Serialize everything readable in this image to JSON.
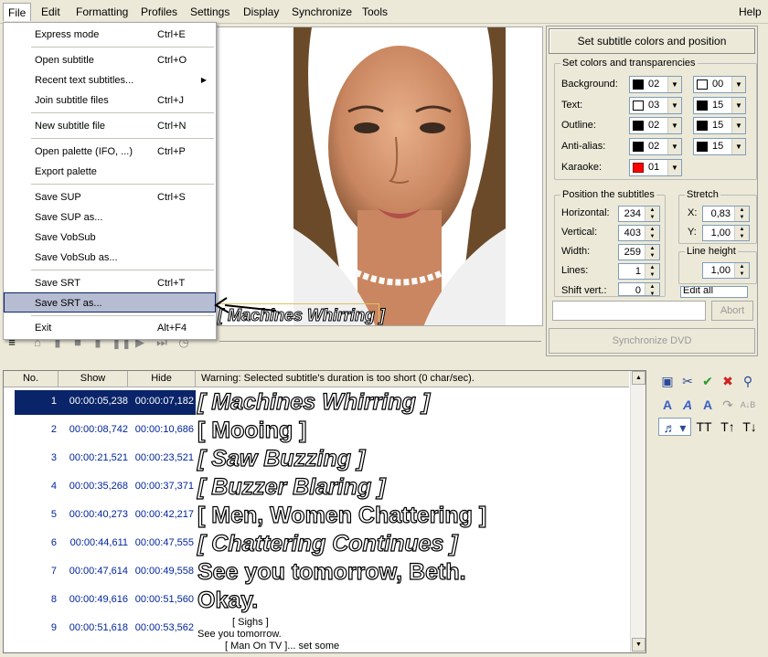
{
  "menubar": {
    "items": [
      {
        "label": "File"
      },
      {
        "label": "Edit"
      },
      {
        "label": "Formatting"
      },
      {
        "label": "Profiles"
      },
      {
        "label": "Settings"
      },
      {
        "label": "Display"
      },
      {
        "label": "Synchronize"
      },
      {
        "label": "Tools"
      }
    ],
    "help": "Help"
  },
  "file_menu": {
    "items": [
      {
        "label": "Express mode",
        "shortcut": "Ctrl+E"
      },
      {
        "label": "Open subtitle",
        "shortcut": "Ctrl+O"
      },
      {
        "label": "Recent text subtitles...",
        "shortcut": ""
      },
      {
        "label": "Join subtitle files",
        "shortcut": "Ctrl+J"
      },
      {
        "label": "New subtitle file",
        "shortcut": "Ctrl+N"
      },
      {
        "label": "Open palette (IFO, ...)",
        "shortcut": "Ctrl+P"
      },
      {
        "label": "Export palette",
        "shortcut": ""
      },
      {
        "label": "Save SUP",
        "shortcut": "Ctrl+S"
      },
      {
        "label": "Save SUP as...",
        "shortcut": ""
      },
      {
        "label": "Save VobSub",
        "shortcut": ""
      },
      {
        "label": "Save VobSub as...",
        "shortcut": ""
      },
      {
        "label": "Save SRT",
        "shortcut": "Ctrl+T"
      },
      {
        "label": "Save SRT as...",
        "shortcut": ""
      },
      {
        "label": "Exit",
        "shortcut": "Alt+F4"
      }
    ]
  },
  "preview": {
    "subtitle_text": "[ Machines Whirring ]"
  },
  "right_panel": {
    "set_colors_button": "Set subtitle colors and position",
    "colors_group": "Set colors and transparencies",
    "color_rows": [
      {
        "label": "Background:",
        "c1_color": "#000000",
        "c1_value": "02",
        "c2_color": "#ffffff",
        "c2_value": "00"
      },
      {
        "label": "Text:",
        "c1_color": "#ffffff",
        "c1_value": "03",
        "c2_color": "#000000",
        "c2_value": "15"
      },
      {
        "label": "Outline:",
        "c1_color": "#000000",
        "c1_value": "02",
        "c2_color": "#000000",
        "c2_value": "15"
      },
      {
        "label": "Anti-alias:",
        "c1_color": "#000000",
        "c1_value": "02",
        "c2_color": "#000000",
        "c2_value": "15"
      },
      {
        "label": "Karaoke:",
        "c1_color": "#ff0000",
        "c1_value": "01"
      }
    ],
    "position_group": "Position the subtitles",
    "position_rows": [
      {
        "label": "Horizontal:",
        "value": "234"
      },
      {
        "label": "Vertical:",
        "value": "403"
      },
      {
        "label": "Width:",
        "value": "259"
      },
      {
        "label": "Lines:",
        "value": "1"
      },
      {
        "label": "Shift vert.:",
        "value": "0"
      }
    ],
    "stretch_group": "Stretch",
    "stretch_x_label": "X:",
    "stretch_x_value": "0,83",
    "stretch_y_label": "Y:",
    "stretch_y_value": "1,00",
    "line_height_group": "Line height",
    "line_height_value": "1,00",
    "edit_all": "Edit all",
    "abort_button": "Abort",
    "sync_button": "Synchronize DVD"
  },
  "subtitle_list": {
    "headers": {
      "no": "No.",
      "show": "Show",
      "hide": "Hide",
      "warning": "Warning: Selected subtitle's duration is too short (0 char/sec)."
    },
    "rows": [
      {
        "no": "1",
        "show": "00:00:05,238",
        "hide": "00:00:07,182",
        "text": "[ Machines Whirring ]",
        "italic": true
      },
      {
        "no": "2",
        "show": "00:00:08,742",
        "hide": "00:00:10,686",
        "text": "[ Mooing ]",
        "italic": false
      },
      {
        "no": "3",
        "show": "00:00:21,521",
        "hide": "00:00:23,521",
        "text": "[ Saw Buzzing ]",
        "italic": true
      },
      {
        "no": "4",
        "show": "00:00:35,268",
        "hide": "00:00:37,371",
        "text": "[ Buzzer Blaring ]",
        "italic": true
      },
      {
        "no": "5",
        "show": "00:00:40,273",
        "hide": "00:00:42,217",
        "text": "[ Men, Women Chattering ]",
        "italic": false
      },
      {
        "no": "6",
        "show": "00:00:44,611",
        "hide": "00:00:47,555",
        "text": "[ Chattering Continues ]",
        "italic": true
      },
      {
        "no": "7",
        "show": "00:00:47,614",
        "hide": "00:00:49,558",
        "text": "See you tomorrow, Beth.",
        "italic": false
      },
      {
        "no": "8",
        "show": "00:00:49,616",
        "hide": "00:00:51,560",
        "text": "Okay.",
        "italic": false
      },
      {
        "no": "9",
        "show": "00:00:51,618",
        "hide": "00:00:53,562",
        "text_line1": "[ Sighs ]",
        "text_line2": "See you tomorrow.",
        "text_line3": "[ Man On TV ]... set some"
      }
    ]
  }
}
